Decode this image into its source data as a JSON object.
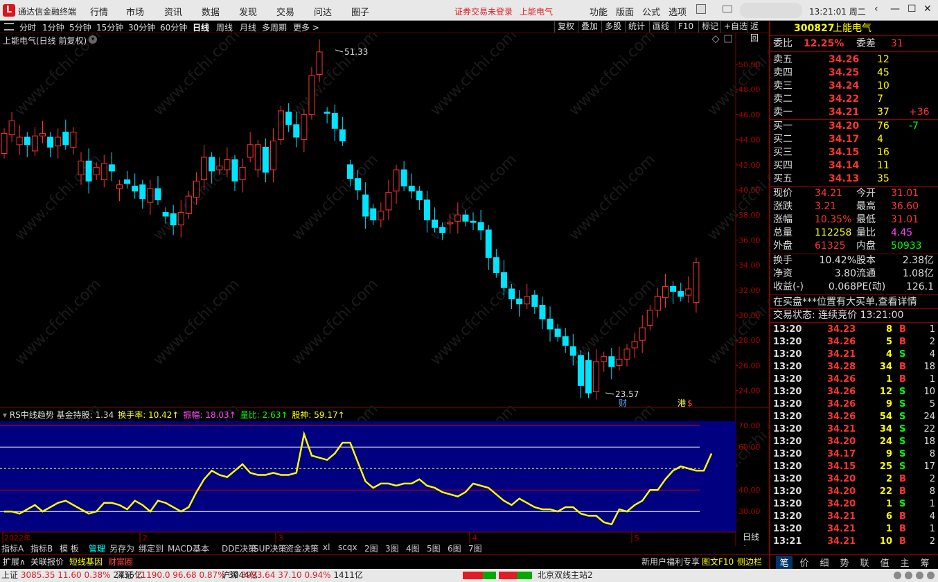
{
  "app": {
    "title": "通达信金融终端",
    "warning": "证券交易未登录",
    "stock_name": "上能电气",
    "menus": [
      "行情",
      "市场",
      "资讯",
      "数据",
      "发现",
      "交易",
      "问达",
      "圈子"
    ],
    "right_menus": [
      "功能",
      "版面",
      "公式",
      "选项"
    ],
    "clock": "13:21:01 周二"
  },
  "toolbar": {
    "periods": [
      "分时",
      "1分钟",
      "5分钟",
      "15分钟",
      "30分钟",
      "60分钟",
      "日线",
      "周线",
      "月线",
      "多周期",
      "更多 >"
    ],
    "active": "日线",
    "tools": [
      "复权",
      "叠加",
      "多股",
      "统计",
      "画线",
      "F10",
      "标记",
      "+自选",
      "返回"
    ]
  },
  "chart": {
    "label": "上能电气(日线 前复权)",
    "high_label": "51.33",
    "low_label": "23.57",
    "markers": [
      "财",
      "港",
      "$"
    ],
    "watermark": "www.cfchi.com",
    "y_ticks": [
      "50.00",
      "48.00",
      "46.00",
      "44.00",
      "42.00",
      "40.00",
      "38.00",
      "36.00",
      "34.00",
      "32.00",
      "30.00",
      "28.00",
      "26.00",
      "24.00"
    ],
    "x_labels": [
      "2022年",
      "2",
      "3",
      "4",
      "5"
    ],
    "period_btn": "日线"
  },
  "indicator": {
    "name": "RS中线趋势",
    "items": [
      {
        "label": "基金持股: ",
        "value": "1.34",
        "color": "#dddddd"
      },
      {
        "label": "换手率: ",
        "value": "10.42↑",
        "color": "#ffff00"
      },
      {
        "label": "振幅: ",
        "value": "18.03↑",
        "color": "#ff44ff"
      },
      {
        "label": "量比: ",
        "value": "2.63↑",
        "color": "#00ff00"
      },
      {
        "label": "股神: ",
        "value": "59.17↑",
        "color": "#ffff00"
      }
    ],
    "y_ticks": [
      "70.00",
      "60.00",
      "40.00",
      "30.00"
    ]
  },
  "ind_tabs": [
    "指标A",
    "指标B",
    "模 板",
    "管理",
    "另存为",
    "绑定到",
    "MACD基本",
    "DDE决策",
    "SUP决策",
    "资金决策",
    "xl",
    "scqx",
    "2图",
    "3图",
    "4图",
    "5图",
    "6图",
    "7图"
  ],
  "bottom_tabs": [
    "扩展∧",
    "关联报价",
    "短线基因",
    "财富圈"
  ],
  "promo": "新用户福利专享",
  "promo2": "图文F10",
  "promo3": "侧边栏 «",
  "quote": {
    "code": "300827",
    "name": "上能电气",
    "weibi_label": "委比",
    "weibi": "12.25%",
    "weicha_label": "委差",
    "weicha": "31",
    "sells": [
      {
        "l": "卖五",
        "p": "34.26",
        "v": "12",
        "c": ""
      },
      {
        "l": "卖四",
        "p": "34.25",
        "v": "45",
        "c": ""
      },
      {
        "l": "卖三",
        "p": "34.24",
        "v": "10",
        "c": ""
      },
      {
        "l": "卖二",
        "p": "34.22",
        "v": "7",
        "c": ""
      },
      {
        "l": "卖一",
        "p": "34.21",
        "v": "37",
        "c": "+36"
      }
    ],
    "buys": [
      {
        "l": "买一",
        "p": "34.20",
        "v": "76",
        "c": "-7"
      },
      {
        "l": "买二",
        "p": "34.17",
        "v": "4",
        "c": ""
      },
      {
        "l": "买三",
        "p": "34.15",
        "v": "16",
        "c": ""
      },
      {
        "l": "买四",
        "p": "34.14",
        "v": "11",
        "c": ""
      },
      {
        "l": "买五",
        "p": "34.13",
        "v": "35",
        "c": ""
      }
    ],
    "stats": [
      {
        "a": "现价",
        "av": "34.21",
        "b": "今开",
        "bv": "31.01",
        "ac": "#ff3333",
        "bc": "#ff3333"
      },
      {
        "a": "涨跌",
        "av": "3.21",
        "b": "最高",
        "bv": "36.60",
        "ac": "#ff3333",
        "bc": "#ff3333"
      },
      {
        "a": "涨幅",
        "av": "10.35%",
        "b": "最低",
        "bv": "31.01",
        "ac": "#ff3333",
        "bc": "#ff3333"
      },
      {
        "a": "总量",
        "av": "112258",
        "b": "量比",
        "bv": "4.45",
        "ac": "#ffff00",
        "bc": "#ff44ff"
      },
      {
        "a": "外盘",
        "av": "61325",
        "b": "内盘",
        "bv": "50933",
        "ac": "#ff3333",
        "bc": "#00ff00"
      }
    ],
    "stats2": [
      {
        "a": "换手",
        "av": "10.42%",
        "b": "股本",
        "bv": "2.38亿"
      },
      {
        "a": "净资",
        "av": "3.80",
        "b": "流通",
        "bv": "1.08亿"
      },
      {
        "a": "收益(-)",
        "av": "0.068",
        "b": "PE(动)",
        "bv": "126.1"
      }
    ],
    "notice": "在买盘***位置有大买单,查看详情",
    "state": "交易状态: 连续竞价 13:21:00",
    "ticks": [
      [
        "13:20",
        "34.23",
        "8",
        "B",
        "1"
      ],
      [
        "13:20",
        "34.26",
        "5",
        "B",
        "2"
      ],
      [
        "13:20",
        "34.21",
        "4",
        "S",
        "4"
      ],
      [
        "13:20",
        "34.28",
        "34",
        "B",
        "18"
      ],
      [
        "13:20",
        "34.26",
        "1",
        "B",
        "1"
      ],
      [
        "13:20",
        "34.26",
        "12",
        "S",
        "10"
      ],
      [
        "13:20",
        "34.26",
        "9",
        "S",
        "5"
      ],
      [
        "13:20",
        "34.26",
        "54",
        "S",
        "24"
      ],
      [
        "13:20",
        "34.21",
        "34",
        "S",
        "22"
      ],
      [
        "13:20",
        "34.20",
        "24",
        "S",
        "18"
      ],
      [
        "13:20",
        "34.17",
        "9",
        "S",
        "8"
      ],
      [
        "13:20",
        "34.15",
        "25",
        "S",
        "17"
      ],
      [
        "13:20",
        "34.20",
        "2",
        "B",
        "2"
      ],
      [
        "13:20",
        "34.20",
        "22",
        "B",
        "8"
      ],
      [
        "13:20",
        "34.20",
        "1",
        "S",
        "1"
      ],
      [
        "13:20",
        "34.21",
        "6",
        "B",
        "4"
      ],
      [
        "13:20",
        "34.21",
        "1",
        "B",
        "1"
      ],
      [
        "13:21",
        "34.21",
        "10",
        "B",
        "2"
      ]
    ],
    "side_tabs": [
      "笔",
      "价",
      "细",
      "势",
      "联",
      "值",
      "主",
      "筹"
    ]
  },
  "status": {
    "items": [
      {
        "n": "上证",
        "v": "3085.35",
        "c": "11.60",
        "p": "0.38%",
        "a": "2436亿"
      },
      {
        "n": "深证",
        "v": "11190.0",
        "c": "96.68",
        "p": "0.87%",
        "a": "3044亿"
      },
      {
        "n": "沪深",
        "v": "3993.64",
        "c": "37.10",
        "p": "0.94%",
        "a": "1411亿"
      }
    ],
    "server": "北京双线主站2"
  }
}
